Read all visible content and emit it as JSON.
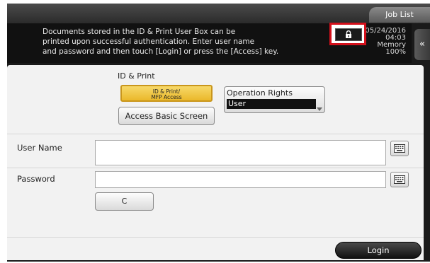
{
  "header": {
    "job_list_label": "Job List",
    "message_lines": [
      "Documents stored in the ID & Print User Box can be",
      "printed upon successful authentication. Enter user name",
      "and password and then touch [Login] or press the [Access] key."
    ],
    "date": "05/24/2016",
    "time": "04:03",
    "memory_label": "Memory",
    "memory_value": "100%",
    "side_tab_icon": "double-chevron-left-icon",
    "lock_icon": "lock-icon"
  },
  "panel": {
    "section_label": "ID & Print",
    "id_print_button": {
      "line1": "ID & Print/",
      "line2": "MFP Access"
    },
    "access_basic_label": "Access Basic Screen",
    "operation_rights": {
      "label": "Operation Rights",
      "value": "User"
    },
    "user_name_label": "User Name",
    "password_label": "Password",
    "clear_label": "C",
    "login_label": "Login",
    "keyboard_icon": "keyboard-icon"
  },
  "colors": {
    "highlight_border": "#d4101b",
    "selected_button": "#eab82a",
    "panel_bg": "#f2f2f2",
    "header_bg": "#111111"
  }
}
